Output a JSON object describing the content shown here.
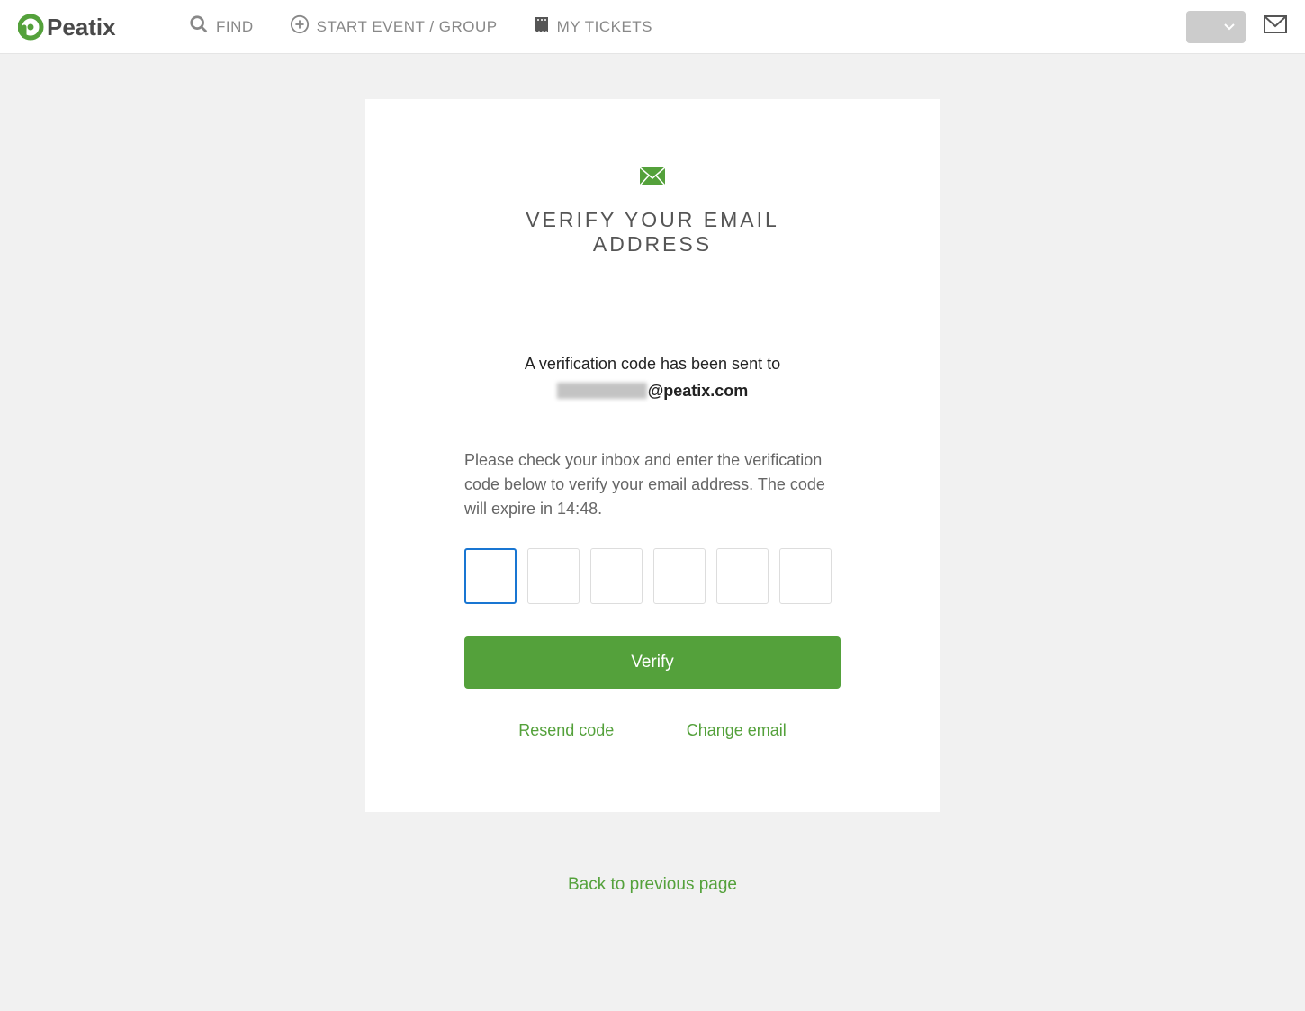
{
  "header": {
    "brand": "Peatix",
    "nav": {
      "find": "FIND",
      "start": "START EVENT / GROUP",
      "tickets": "MY TICKETS"
    }
  },
  "card": {
    "title": "VERIFY YOUR EMAIL ADDRESS",
    "sent_prefix": "A verification code has been sent to",
    "email_domain": "@peatix.com",
    "instructions_prefix": "Please check your inbox and enter the verification code below to verify your email address. The code will expire in ",
    "timer": "14:48",
    "instructions_suffix": ".",
    "verify_button": "Verify",
    "resend_link": "Resend code",
    "change_email_link": "Change email"
  },
  "footer": {
    "back_link": "Back to previous page"
  },
  "colors": {
    "brand_green": "#54a13b",
    "text_gray": "#888"
  }
}
